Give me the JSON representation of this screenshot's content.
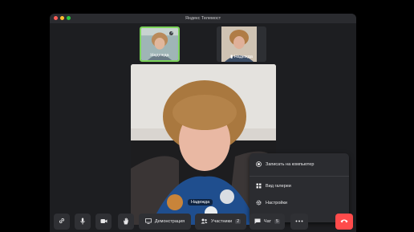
{
  "window": {
    "title": "Яндекс Телемост",
    "traffic_lights": [
      "#ff5f57",
      "#febc2e",
      "#28c840"
    ]
  },
  "participants": [
    {
      "name": "Надежда",
      "active": true
    },
    {
      "name": "Надежда",
      "active": false
    }
  ],
  "main_video": {
    "name": "Надежда"
  },
  "more_menu": {
    "items": [
      {
        "label": "Записать на компьютер",
        "icon": "record-icon"
      },
      {
        "label": "Вид галереи",
        "icon": "gallery-grid-icon"
      },
      {
        "label": "Настройки",
        "icon": "gear-icon"
      }
    ]
  },
  "toolbar": {
    "link_icon": "link-icon",
    "mic_icon": "microphone-icon",
    "camera_icon": "camera-icon",
    "hand_icon": "raise-hand-icon",
    "screen_share_label": "Демонстрация",
    "participants_label": "Участники",
    "participants_count": "2",
    "chat_label": "Чат",
    "chat_count": "5",
    "more_icon": "more-dots-icon",
    "hangup_icon": "hang-up-icon",
    "hangup_color": "#ff4b4b",
    "active_border_color": "#7dd45b"
  }
}
